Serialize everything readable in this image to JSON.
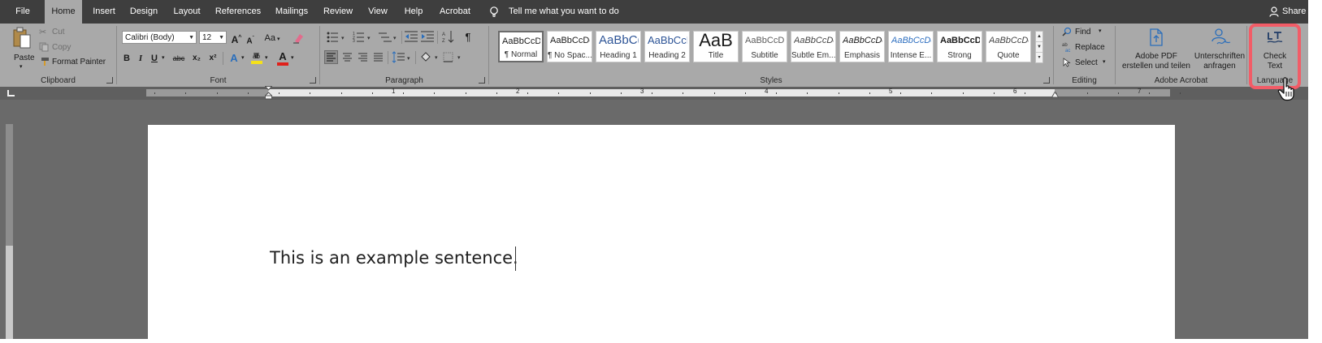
{
  "tabs": [
    "File",
    "Home",
    "Insert",
    "Design",
    "Layout",
    "References",
    "Mailings",
    "Review",
    "View",
    "Help",
    "Acrobat"
  ],
  "active_tab": "Home",
  "tell_me": "Tell me what you want to do",
  "share": "Share",
  "clipboard": {
    "paste": "Paste",
    "cut": "Cut",
    "copy": "Copy",
    "format_painter": "Format Painter",
    "label": "Clipboard"
  },
  "font": {
    "family": "Calibri (Body)",
    "size": "12",
    "change_case": "Aa",
    "bold": "B",
    "italic": "I",
    "underline": "U",
    "strikethrough": "abc",
    "subscript": "x₂",
    "superscript": "x²",
    "font_color_letter": "A",
    "label": "Font"
  },
  "paragraph": {
    "label": "Paragraph"
  },
  "styles": {
    "items": [
      {
        "preview": "AaBbCcDc",
        "name": "¶ Normal"
      },
      {
        "preview": "AaBbCcDc",
        "name": "¶ No Spac..."
      },
      {
        "preview": "AaBbC(",
        "name": "Heading 1"
      },
      {
        "preview": "AaBbCcD",
        "name": "Heading 2"
      },
      {
        "preview": "AaB",
        "name": "Title"
      },
      {
        "preview": "AaBbCcD",
        "name": "Subtitle"
      },
      {
        "preview": "AaBbCcDc",
        "name": "Subtle Em..."
      },
      {
        "preview": "AaBbCcDc",
        "name": "Emphasis"
      },
      {
        "preview": "AaBbCcDc",
        "name": "Intense E..."
      },
      {
        "preview": "AaBbCcDc",
        "name": "Strong"
      },
      {
        "preview": "AaBbCcDc",
        "name": "Quote"
      }
    ],
    "label": "Styles"
  },
  "editing": {
    "find": "Find",
    "replace": "Replace",
    "select": "Select",
    "label": "Editing"
  },
  "acrobat": {
    "create_pdf_line1": "Adobe PDF",
    "create_pdf_line2": "erstellen und teilen",
    "signatures_line1": "Unterschriften",
    "signatures_line2": "anfragen",
    "label": "Adobe Acrobat"
  },
  "language": {
    "check_text_line1": "Check",
    "check_text_line2": "Text",
    "label": "Language"
  },
  "ruler_numbers": [
    "1",
    "2",
    "3",
    "4",
    "5",
    "6",
    "7"
  ],
  "document": {
    "text": "This is an example sentence."
  },
  "colors": {
    "highlight_border": "#f25c67",
    "tab_bar": "#3e3e3e",
    "ribbon": "#a9a9a9",
    "acrobat_blue": "#2a6ebb",
    "font_color_red": "#e0201a",
    "highlight_yellow": "#f5e11a"
  }
}
